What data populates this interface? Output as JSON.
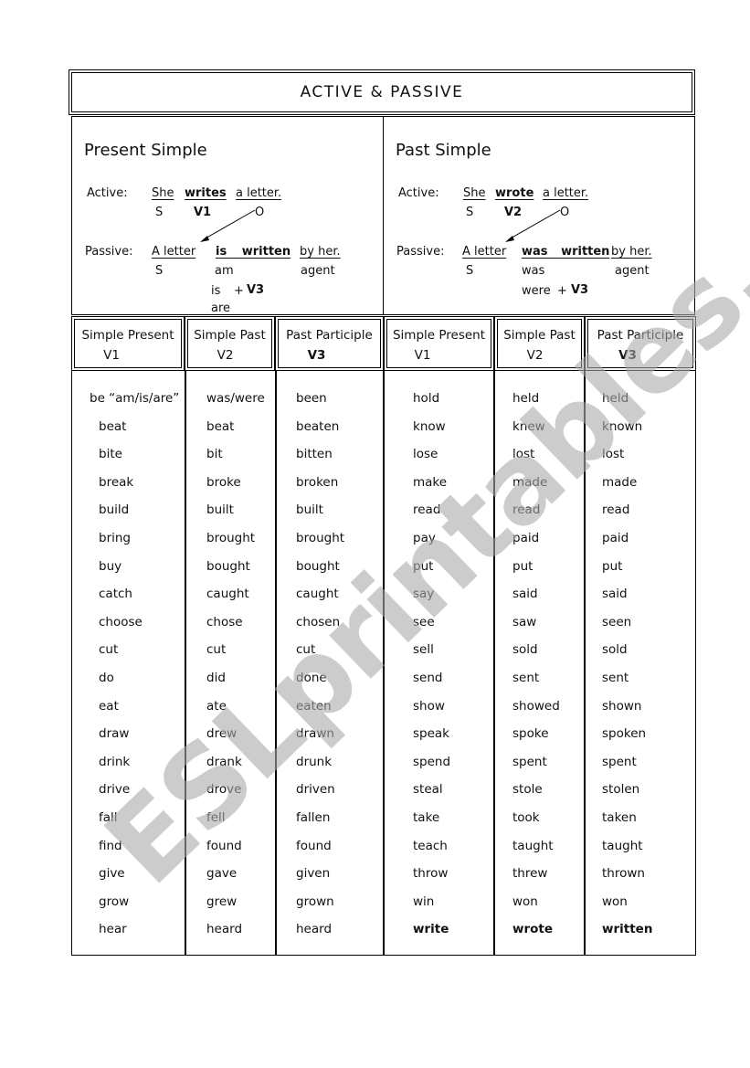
{
  "title": "ACTIVE  &  PASSIVE",
  "examples": {
    "present": {
      "heading": "Present Simple",
      "active_label": "Active:",
      "active_subject": "She",
      "active_verb": "writes",
      "active_object": "a letter.",
      "active_s": "S",
      "active_v": "V1",
      "active_o": "O",
      "passive_label": "Passive:",
      "passive_subject": "A letter",
      "passive_aux": "is",
      "passive_verb": "written",
      "passive_agent": "by  her.",
      "passive_s": "S",
      "passive_aux_1": "am",
      "passive_aux_2": "is",
      "plus": "+",
      "passive_v": "V3",
      "passive_aux_3": "are",
      "agent_label": "agent"
    },
    "past": {
      "heading": "Past Simple",
      "active_label": "Active:",
      "active_subject": "She",
      "active_verb": "wrote",
      "active_object": "a letter.",
      "active_s": "S",
      "active_v": "V2",
      "active_o": "O",
      "passive_label": "Passive:",
      "passive_subject": "A letter",
      "passive_aux": "was",
      "passive_verb": "written",
      "passive_agent": "by  her.",
      "passive_s": "S",
      "passive_aux_1": "was",
      "passive_aux_2": "were",
      "plus": "+",
      "passive_v": "V3",
      "agent_label": "agent"
    }
  },
  "table": {
    "headers": [
      {
        "label": "Simple Present",
        "sub": "V1",
        "bold": false
      },
      {
        "label": "Simple Past",
        "sub": "V2",
        "bold": false
      },
      {
        "label": "Past Participle",
        "sub": "V3",
        "bold": true
      },
      {
        "label": "Simple Present",
        "sub": "V1",
        "bold": false
      },
      {
        "label": "Simple Past",
        "sub": "V2",
        "bold": false
      },
      {
        "label": "Past Participle",
        "sub": "V3",
        "bold": true
      }
    ],
    "left_rows": [
      [
        "be “am/is/are”",
        "was/were",
        "been"
      ],
      [
        "beat",
        "beat",
        "beaten"
      ],
      [
        "bite",
        "bit",
        "bitten"
      ],
      [
        "break",
        "broke",
        "broken"
      ],
      [
        "build",
        "built",
        "built"
      ],
      [
        "bring",
        "brought",
        "brought"
      ],
      [
        "buy",
        "bought",
        "bought"
      ],
      [
        "catch",
        "caught",
        "caught"
      ],
      [
        "choose",
        "chose",
        "chosen"
      ],
      [
        "cut",
        "cut",
        "cut"
      ],
      [
        "do",
        "did",
        "done"
      ],
      [
        "eat",
        "ate",
        "eaten"
      ],
      [
        "draw",
        "drew",
        "drawn"
      ],
      [
        "drink",
        "drank",
        "drunk"
      ],
      [
        "drive",
        "drove",
        "driven"
      ],
      [
        "fall",
        "fell",
        "fallen"
      ],
      [
        "find",
        "found",
        "found"
      ],
      [
        "give",
        "gave",
        "given"
      ],
      [
        "grow",
        "grew",
        "grown"
      ],
      [
        "hear",
        "heard",
        "heard"
      ]
    ],
    "right_rows": [
      [
        "hold",
        "held",
        "held"
      ],
      [
        "know",
        "knew",
        "known"
      ],
      [
        "lose",
        "lost",
        "lost"
      ],
      [
        "make",
        "made",
        "made"
      ],
      [
        "read",
        "read",
        "read"
      ],
      [
        "pay",
        "paid",
        "paid"
      ],
      [
        "put",
        "put",
        "put"
      ],
      [
        "say",
        "said",
        "said"
      ],
      [
        "see",
        "saw",
        "seen"
      ],
      [
        "sell",
        "sold",
        "sold"
      ],
      [
        "send",
        "sent",
        "sent"
      ],
      [
        "show",
        "showed",
        "shown"
      ],
      [
        "speak",
        "spoke",
        "spoken"
      ],
      [
        "spend",
        "spent",
        "spent"
      ],
      [
        "steal",
        "stole",
        "stolen"
      ],
      [
        "take",
        "took",
        "taken"
      ],
      [
        "teach",
        "taught",
        "taught"
      ],
      [
        "throw",
        "threw",
        "thrown"
      ],
      [
        "win",
        "won",
        "won"
      ],
      [
        "write",
        "wrote",
        "written"
      ]
    ],
    "bold_right_row_index": 19
  },
  "watermark": "ESLprintables.com"
}
